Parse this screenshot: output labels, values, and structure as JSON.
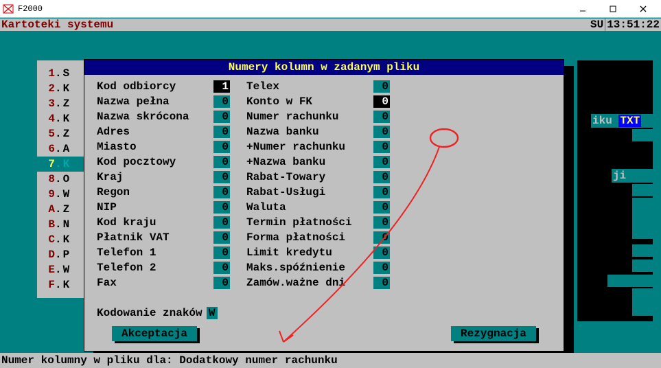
{
  "window": {
    "title": "F2000"
  },
  "topbar": {
    "menu": "Kartoteki systemu",
    "indicator": "SU",
    "clock": "13:51:22"
  },
  "back_list": [
    {
      "idx": "1",
      "ch": "S"
    },
    {
      "idx": "2",
      "ch": "K"
    },
    {
      "idx": "3",
      "ch": "Z"
    },
    {
      "idx": "4",
      "ch": "K"
    },
    {
      "idx": "5",
      "ch": "Z"
    },
    {
      "idx": "6",
      "ch": "A"
    },
    {
      "idx": "7",
      "ch": "K",
      "selected": true
    },
    {
      "idx": "8",
      "ch": "O"
    },
    {
      "idx": "9",
      "ch": "W"
    },
    {
      "idx": "A",
      "ch": "Z"
    },
    {
      "idx": "B",
      "ch": "N"
    },
    {
      "idx": "C",
      "ch": "K"
    },
    {
      "idx": "D",
      "ch": "P"
    },
    {
      "idx": "E",
      "ch": "W"
    },
    {
      "idx": "F",
      "ch": "K"
    }
  ],
  "dialog": {
    "title": "Numery kolumn w zadanym pliku",
    "left": [
      {
        "label": "Kod odbiorcy",
        "val": "1",
        "sel": true
      },
      {
        "label": "Nazwa pełna",
        "val": "0"
      },
      {
        "label": "Nazwa skrócona",
        "val": "0"
      },
      {
        "label": "Adres",
        "val": "0"
      },
      {
        "label": "Miasto",
        "val": "0"
      },
      {
        "label": "Kod pocztowy",
        "val": "0"
      },
      {
        "label": "Kraj",
        "val": "0"
      },
      {
        "label": "Regon",
        "val": "0"
      },
      {
        "label": "NIP",
        "val": "0"
      },
      {
        "label": "Kod kraju",
        "val": "0"
      },
      {
        "label": "Płatnik VAT",
        "val": "0"
      },
      {
        "label": "Telefon 1",
        "val": "0"
      },
      {
        "label": "Telefon 2",
        "val": "0"
      },
      {
        "label": "Fax",
        "val": "0"
      }
    ],
    "right": [
      {
        "label": "Telex",
        "val": "0"
      },
      {
        "label": "Konto w FK",
        "val": "0",
        "sel": true
      },
      {
        "label": "Numer rachunku",
        "val": "0"
      },
      {
        "label": "Nazwa banku",
        "val": "0"
      },
      {
        "label": "+Numer rachunku",
        "val": "0",
        "circled": true
      },
      {
        "label": "+Nazwa banku",
        "val": "0"
      },
      {
        "label": "Rabat-Towary",
        "val": "0"
      },
      {
        "label": "Rabat-Usługi",
        "val": "0"
      },
      {
        "label": "Waluta",
        "val": "0"
      },
      {
        "label": "Termin płatności",
        "val": "0"
      },
      {
        "label": "Forma płatności",
        "val": "0"
      },
      {
        "label": "Limit kredytu",
        "val": "0"
      },
      {
        "label": "Maks.spóźnienie",
        "val": "0"
      },
      {
        "label": "Zamów.ważne dni",
        "val": "0"
      }
    ],
    "encoding_label": "Kodowanie znaków",
    "encoding_value": "W",
    "accept": "Akceptacja",
    "cancel": "Rezygnacja"
  },
  "side": {
    "text1": "iku",
    "text2": "TXT",
    "text3": "ji"
  },
  "statusbar": "Numer kolumny w pliku dla: Dodatkowy numer rachunku"
}
